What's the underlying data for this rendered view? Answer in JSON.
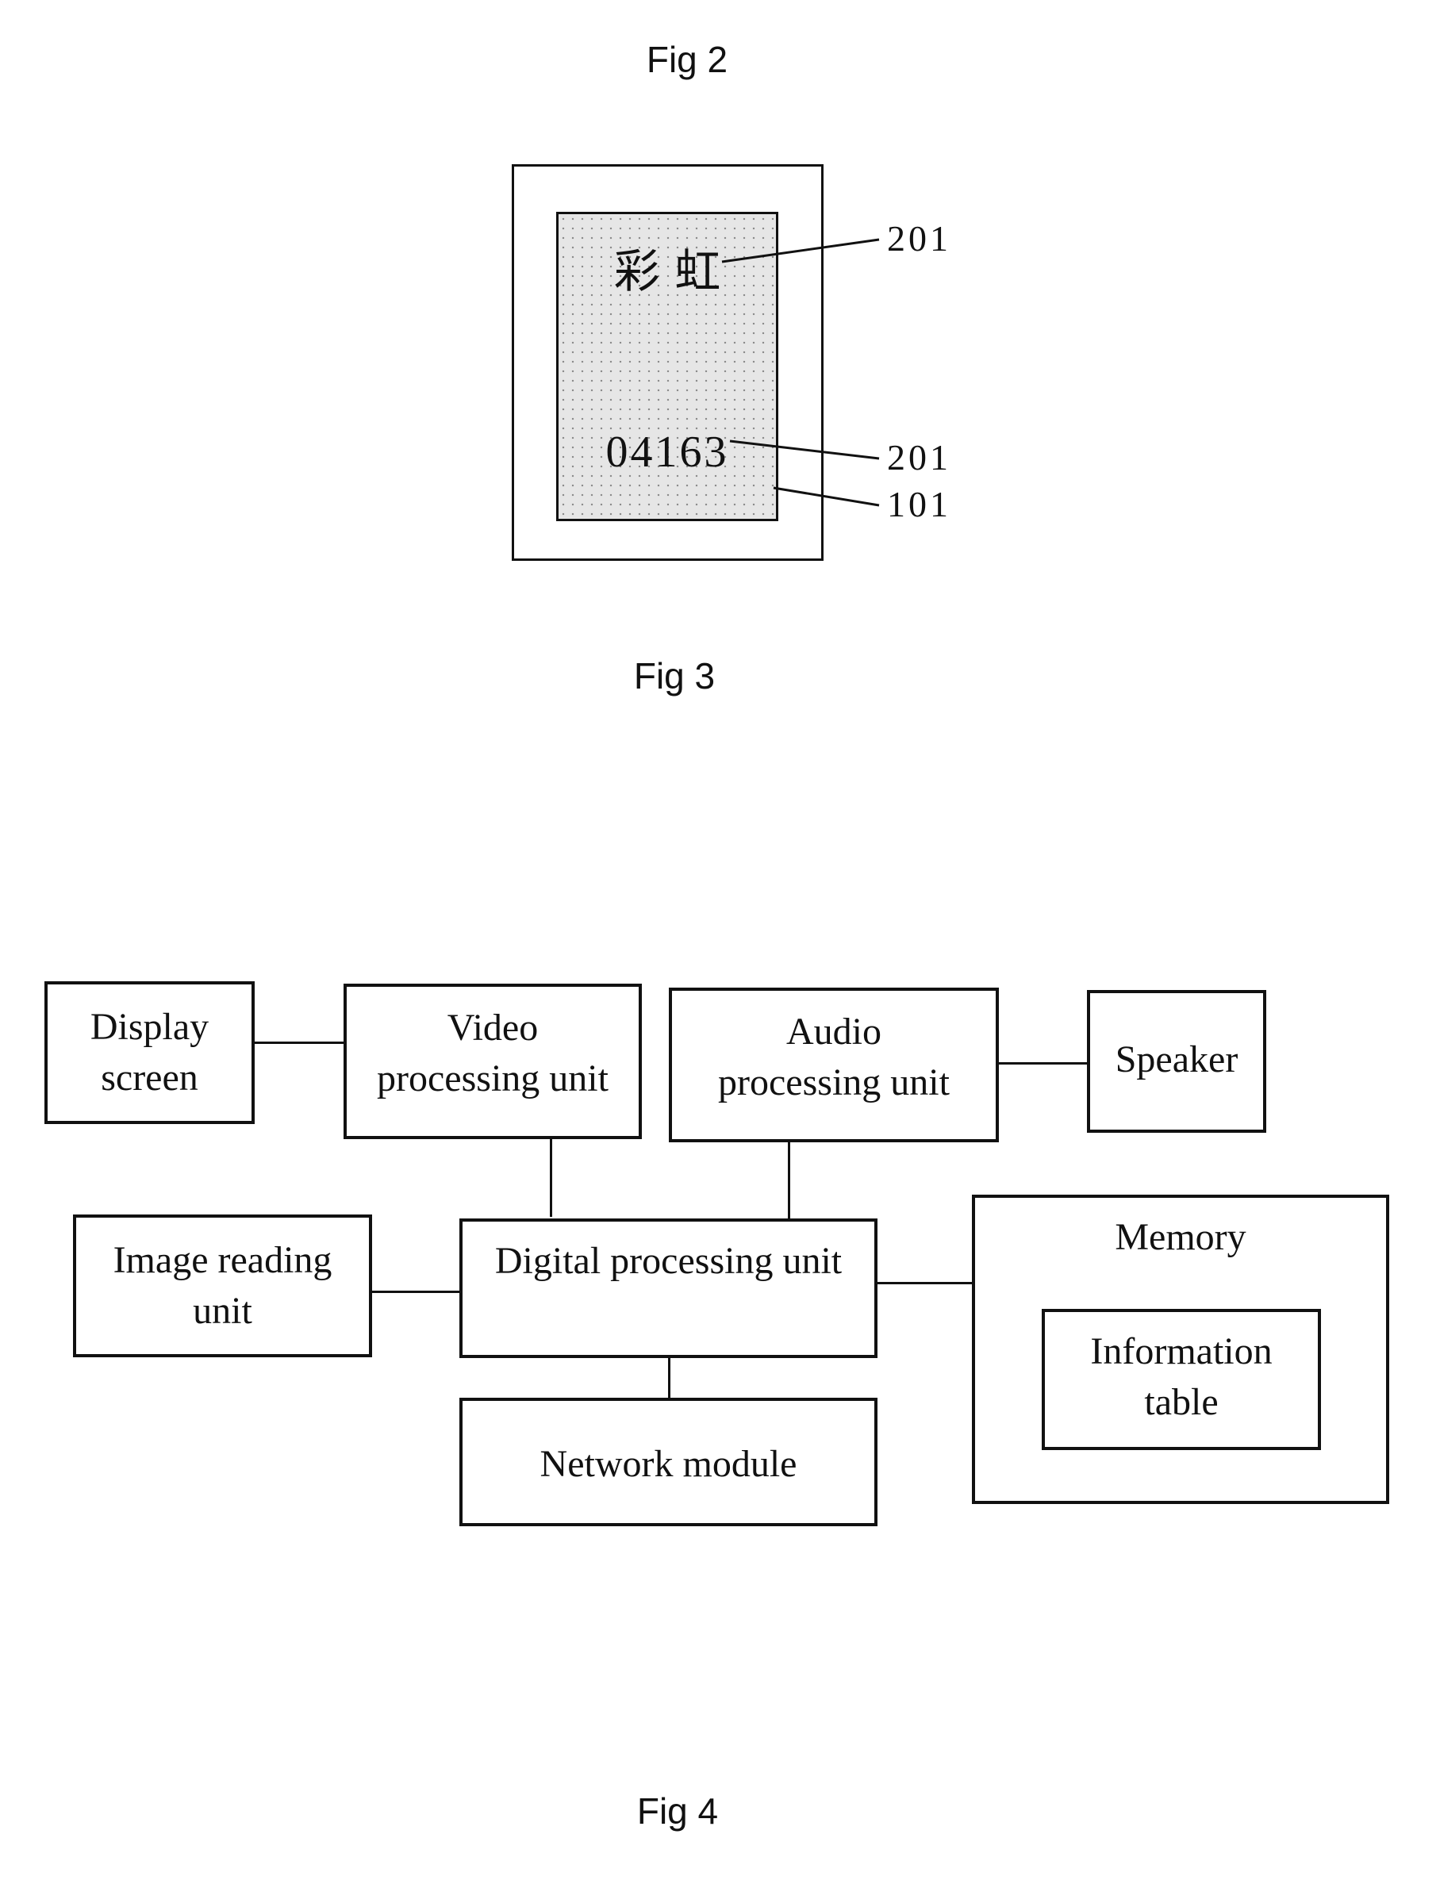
{
  "fig2": {
    "caption": "Fig 2"
  },
  "fig3": {
    "caption": "Fig 3",
    "card": {
      "chinese_text": "彩  虹",
      "number_text": "04163"
    },
    "reference_labels": [
      "201",
      "201",
      "101"
    ]
  },
  "fig4": {
    "caption": "Fig 4",
    "blocks": {
      "display_screen": [
        "Display",
        "screen"
      ],
      "video_processing": [
        "Video",
        "processing unit"
      ],
      "audio_processing": [
        "Audio",
        "processing unit"
      ],
      "speaker": [
        "Speaker"
      ],
      "image_reading": [
        "Image reading",
        "unit"
      ],
      "digital_processing": [
        "Digital processing unit"
      ],
      "memory": [
        "Memory"
      ],
      "information_table": [
        "Information",
        "table"
      ],
      "network_module": [
        "Network module"
      ]
    }
  }
}
